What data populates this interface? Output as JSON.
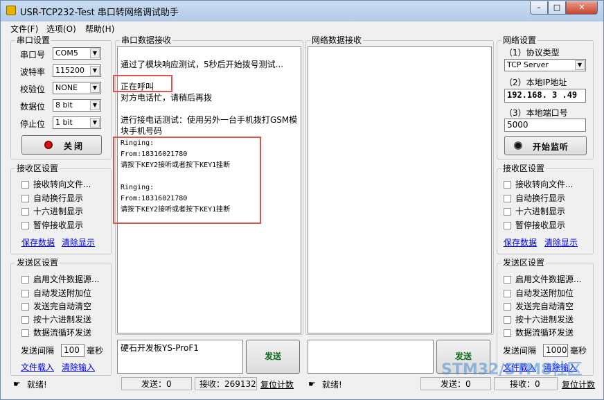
{
  "window": {
    "title": "USR-TCP232-Test 串口转网络调试助手",
    "min": "–",
    "max": "□",
    "close": "✕"
  },
  "menu": [
    "文件(F)",
    "选项(O)",
    "帮助(H)"
  ],
  "serial_settings": {
    "title": "串口设置",
    "fields": [
      {
        "label": "串口号",
        "value": "COM5"
      },
      {
        "label": "波特率",
        "value": "115200"
      },
      {
        "label": "校验位",
        "value": "NONE"
      },
      {
        "label": "数据位",
        "value": "8 bit"
      },
      {
        "label": "停止位",
        "value": "1 bit"
      }
    ],
    "close_button": "关闭"
  },
  "left_recv": {
    "title": "接收区设置",
    "options": [
      "接收转向文件...",
      "自动换行显示",
      "十六进制显示",
      "暂停接收显示"
    ],
    "links": [
      "保存数据",
      "清除显示"
    ]
  },
  "left_send": {
    "title": "发送区设置",
    "options": [
      "启用文件数据源...",
      "自动发送附加位",
      "发送完自动清空",
      "按十六进制发送",
      "数据流循环发送"
    ],
    "interval_label": "发送间隔",
    "interval_value": "100",
    "interval_unit": "毫秒",
    "links": [
      "文件载入",
      "清除输入"
    ]
  },
  "serial_recv": {
    "title": "串口数据接收",
    "lines": [
      {
        "text": "通过了模块响应测试，5秒后开始拨号测试...",
        "mono": false
      },
      {
        "text": "正在呼叫",
        "mono": false
      },
      {
        "text": "对方电话忙，请稍后再拨",
        "mono": false
      },
      {
        "text": "进行接电话测试：使用另外一台手机拨打GSM模",
        "mono": false
      },
      {
        "text": "块手机号码",
        "mono": false
      },
      {
        "text": "Ringing:",
        "mono": true
      },
      {
        "text": "From:18316021780",
        "mono": true
      },
      {
        "text": "请按下KEY2接听或者按下KEY1挂断",
        "mono": true
      },
      {
        "text": "Ringing:",
        "mono": true
      },
      {
        "text": "From:18316021780",
        "mono": true
      },
      {
        "text": "请按下KEY2接听或者按下KEY1挂断",
        "mono": true
      }
    ]
  },
  "net_recv": {
    "title": "网络数据接收"
  },
  "serial_send": {
    "input_text": "硬石开发板YS-ProF1",
    "send_button": "发送"
  },
  "net_send": {
    "input_text": "",
    "send_button": "发送"
  },
  "net_settings": {
    "title": "网络设置",
    "protocol_label": "（1）协议类型",
    "protocol_value": "TCP Server",
    "ip_label": "（2）本地IP地址",
    "ip_value": "192.168. 3 .49",
    "port_label": "（3）本地端口号",
    "port_value": "5000",
    "listen_button": "开始监听"
  },
  "right_recv": {
    "title": "接收区设置",
    "options": [
      "接收转向文件...",
      "自动换行显示",
      "十六进制显示",
      "暂停接收显示"
    ],
    "links": [
      "保存数据",
      "清除显示"
    ]
  },
  "right_send": {
    "title": "发送区设置",
    "options": [
      "启用文件数据源...",
      "自动发送附加位",
      "发送完自动清空",
      "按十六进制发送",
      "数据流循环发送"
    ],
    "interval_label": "发送间隔",
    "interval_value": "1000",
    "interval_unit": "毫秒",
    "links": [
      "文件载入",
      "清除输入"
    ]
  },
  "status_left": {
    "ready": "就绪!",
    "sent": "发送：0",
    "recv": "接收：269132",
    "reset": "复位计数"
  },
  "status_right": {
    "ready": "就绪!",
    "sent": "发送：0",
    "recv": "接收：0",
    "reset": "复位计数"
  },
  "watermark": "STM32/STM8社区"
}
